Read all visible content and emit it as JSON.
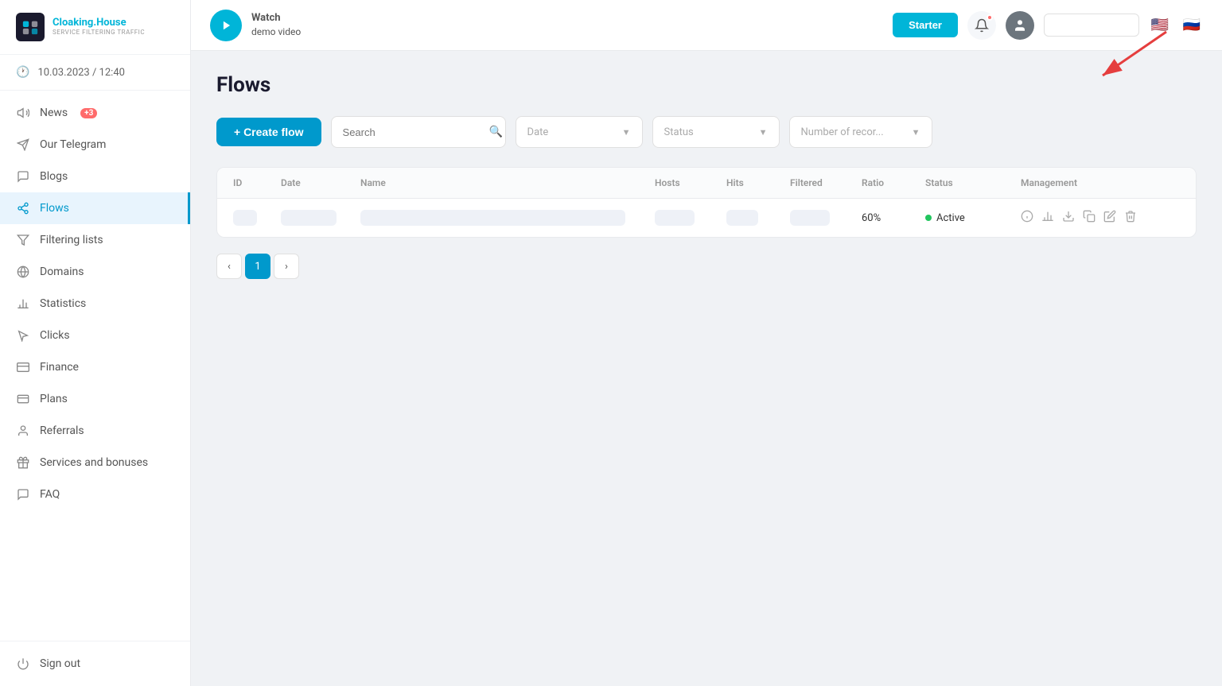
{
  "logo": {
    "text_main_1": "Cloaking",
    "text_main_2": ".House",
    "text_sub": "SERVICE FILTERING TRAFFIC"
  },
  "sidebar": {
    "datetime": "10.03.2023 / 12:40",
    "items": [
      {
        "id": "news",
        "label": "News",
        "icon": "megaphone",
        "badge": "+3"
      },
      {
        "id": "telegram",
        "label": "Our Telegram",
        "icon": "paper-plane",
        "badge": null
      },
      {
        "id": "blogs",
        "label": "Blogs",
        "icon": "comment",
        "badge": null
      },
      {
        "id": "flows",
        "label": "Flows",
        "icon": "share",
        "badge": null,
        "active": true
      },
      {
        "id": "filtering",
        "label": "Filtering lists",
        "icon": "filter",
        "badge": null
      },
      {
        "id": "domains",
        "label": "Domains",
        "icon": "globe",
        "badge": null
      },
      {
        "id": "statistics",
        "label": "Statistics",
        "icon": "chart-bar",
        "badge": null
      },
      {
        "id": "clicks",
        "label": "Clicks",
        "icon": "cursor",
        "badge": null
      },
      {
        "id": "finance",
        "label": "Finance",
        "icon": "dollar",
        "badge": null
      },
      {
        "id": "plans",
        "label": "Plans",
        "icon": "card",
        "badge": null
      },
      {
        "id": "referrals",
        "label": "Referrals",
        "icon": "person",
        "badge": null
      },
      {
        "id": "services",
        "label": "Services and bonuses",
        "icon": "gift",
        "badge": null
      },
      {
        "id": "faq",
        "label": "FAQ",
        "icon": "comment-q",
        "badge": null
      }
    ],
    "bottom_items": [
      {
        "id": "signout",
        "label": "Sign out",
        "icon": "power"
      }
    ]
  },
  "header": {
    "demo_label_line1": "Watch",
    "demo_label_line2": "demo video",
    "starter_label": "Starter",
    "lang_placeholder": ""
  },
  "page": {
    "title": "Flows",
    "create_btn": "+ Create flow",
    "search_placeholder": "Search",
    "date_placeholder": "Date",
    "status_placeholder": "Status",
    "records_placeholder": "Number of recor...",
    "table": {
      "columns": [
        "ID",
        "Date",
        "Name",
        "Hosts",
        "Hits",
        "Filtered",
        "Ratio",
        "Status",
        "Management"
      ],
      "rows": [
        {
          "id": "",
          "date": "",
          "name": "",
          "hosts": "",
          "hits": "",
          "filtered": "",
          "ratio": "60%",
          "status": "Active",
          "blurred": true
        }
      ]
    },
    "pagination": {
      "current": 1,
      "prev_label": "‹",
      "next_label": "›"
    }
  },
  "colors": {
    "primary": "#0099cc",
    "accent": "#00b5d8",
    "active_bg": "#e8f4fd",
    "active_border": "#0099cc",
    "status_active": "#22c55e",
    "badge": "#ff6b6b"
  }
}
